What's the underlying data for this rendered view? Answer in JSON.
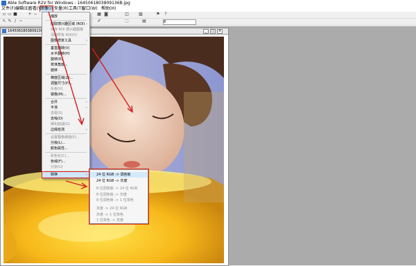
{
  "window": {
    "title": "Able Software R2V for Windows - 1645061803809136B.jpg"
  },
  "menubar": [
    "文件(F)",
    "编辑(E)",
    "查看(V)",
    "图像(I)",
    "矢量(R)",
    "工具(T)",
    "窗口(W)",
    "帮助(H)"
  ],
  "toolbar": {
    "zoom_value": "8"
  },
  "document": {
    "title": "1645061803809136B.jpg"
  },
  "image_menu": {
    "items": [
      {
        "label": "缩放",
        "arrow": false,
        "disabled": false
      },
      {
        "label": "提取感兴趣区域 (ROI)",
        "arrow": true,
        "disabled": false
      },
      {
        "label": "保存 ROI 感兴趣图像",
        "arrow": false,
        "disabled": true
      },
      {
        "label": "清除所有 ROI(O)",
        "arrow": false,
        "disabled": true
      },
      {
        "label": "图像修复工具",
        "arrow": true,
        "disabled": false
      },
      {
        "label": "垂直翻转(V)",
        "arrow": false,
        "disabled": false
      },
      {
        "label": "水平翻转(H)",
        "arrow": false,
        "disabled": false
      },
      {
        "label": "旋转(R)",
        "arrow": false,
        "disabled": false
      },
      {
        "label": "校准角度...",
        "arrow": false,
        "disabled": false
      },
      {
        "label": "旋转",
        "arrow": false,
        "disabled": false
      },
      {
        "label": "梯度区域(Z)...",
        "arrow": false,
        "disabled": false
      },
      {
        "label": "调整尺寸(P)...",
        "arrow": false,
        "disabled": false
      },
      {
        "label": "反色(V)",
        "arrow": false,
        "disabled": true
      },
      {
        "label": "镜像(M)...",
        "arrow": false,
        "disabled": false
      },
      {
        "label": "合并",
        "arrow": true,
        "disabled": false
      },
      {
        "label": "平滑",
        "arrow": true,
        "disabled": false
      },
      {
        "label": "去斑(S)",
        "arrow": false,
        "disabled": true
      },
      {
        "label": "去噪(D)",
        "arrow": false,
        "disabled": false
      },
      {
        "label": "细化削减(G)",
        "arrow": false,
        "disabled": true
      },
      {
        "label": "边缘检测",
        "arrow": true,
        "disabled": false
      },
      {
        "label": "设置图像阈值(E)...",
        "arrow": false,
        "disabled": true
      },
      {
        "label": "分级(L)...",
        "arrow": false,
        "disabled": false
      },
      {
        "label": "颜色属性...",
        "arrow": false,
        "disabled": false
      },
      {
        "label": "彩色化(C)...",
        "arrow": false,
        "disabled": true
      },
      {
        "label": "色域(F)...",
        "arrow": false,
        "disabled": false
      },
      {
        "label": "分割(U)",
        "arrow": false,
        "disabled": true
      },
      {
        "label": "转换",
        "arrow": true,
        "disabled": false
      }
    ]
  },
  "convert_submenu": {
    "items": [
      {
        "label": "24 位 RGB -> 调色板",
        "disabled": false
      },
      {
        "label": "24 位 RGB -> 灰度",
        "disabled": false
      },
      {
        "label": "8 位调色板 -> 24 位 RGB",
        "disabled": true
      },
      {
        "label": "8 位调色板 -> 灰度",
        "disabled": true
      },
      {
        "label": "8 位调色板 -> 1 位单色",
        "disabled": true
      },
      {
        "label": "灰度 -> 24 位 RGB",
        "disabled": true
      },
      {
        "label": "灰度 -> 1 位单色",
        "disabled": true
      },
      {
        "label": "1 位单色 -> 灰度",
        "disabled": true
      }
    ]
  },
  "colors": {
    "highlight_outline": "#d21f1f",
    "arrow": "#d21f1f",
    "menu_highlight": "#cfe6fb"
  }
}
